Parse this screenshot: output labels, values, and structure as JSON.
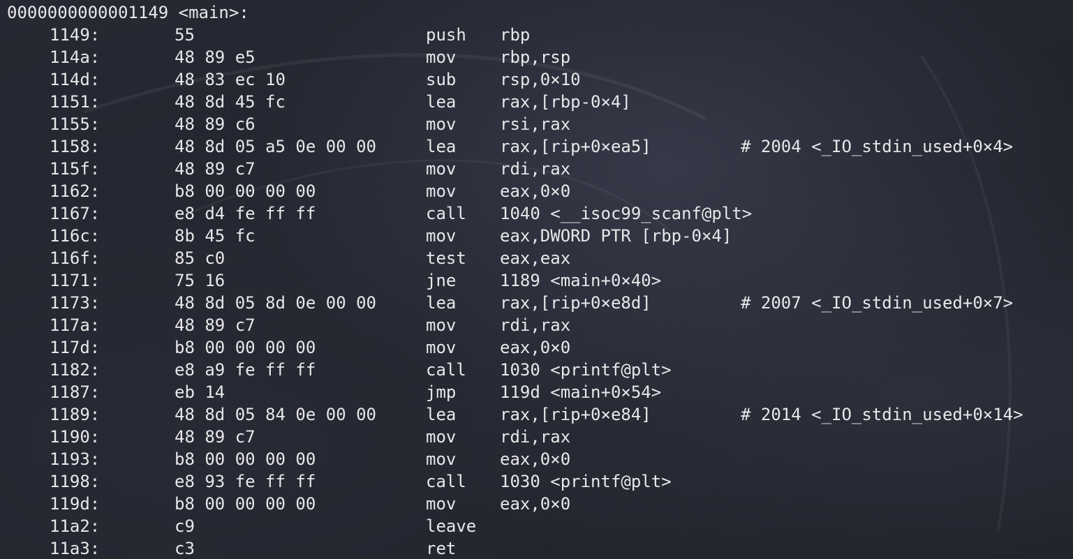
{
  "header": "0000000000001149 <main>:",
  "rows": [
    {
      "addr": "1149:",
      "bytes": "55",
      "mnemonic": "push",
      "operands": "rbp",
      "comment": ""
    },
    {
      "addr": "114a:",
      "bytes": "48 89 e5",
      "mnemonic": "mov",
      "operands": "rbp,rsp",
      "comment": ""
    },
    {
      "addr": "114d:",
      "bytes": "48 83 ec 10",
      "mnemonic": "sub",
      "operands": "rsp,0×10",
      "comment": ""
    },
    {
      "addr": "1151:",
      "bytes": "48 8d 45 fc",
      "mnemonic": "lea",
      "operands": "rax,[rbp-0×4]",
      "comment": ""
    },
    {
      "addr": "1155:",
      "bytes": "48 89 c6",
      "mnemonic": "mov",
      "operands": "rsi,rax",
      "comment": ""
    },
    {
      "addr": "1158:",
      "bytes": "48 8d 05 a5 0e 00 00",
      "mnemonic": "lea",
      "operands": "rax,[rip+0×ea5]",
      "comment": "# 2004 <_IO_stdin_used+0×4>"
    },
    {
      "addr": "115f:",
      "bytes": "48 89 c7",
      "mnemonic": "mov",
      "operands": "rdi,rax",
      "comment": ""
    },
    {
      "addr": "1162:",
      "bytes": "b8 00 00 00 00",
      "mnemonic": "mov",
      "operands": "eax,0×0",
      "comment": ""
    },
    {
      "addr": "1167:",
      "bytes": "e8 d4 fe ff ff",
      "mnemonic": "call",
      "operands": "1040 <__isoc99_scanf@plt>",
      "comment": ""
    },
    {
      "addr": "116c:",
      "bytes": "8b 45 fc",
      "mnemonic": "mov",
      "operands": "eax,DWORD PTR [rbp-0×4]",
      "comment": ""
    },
    {
      "addr": "116f:",
      "bytes": "85 c0",
      "mnemonic": "test",
      "operands": "eax,eax",
      "comment": ""
    },
    {
      "addr": "1171:",
      "bytes": "75 16",
      "mnemonic": "jne",
      "operands": "1189 <main+0×40>",
      "comment": ""
    },
    {
      "addr": "1173:",
      "bytes": "48 8d 05 8d 0e 00 00",
      "mnemonic": "lea",
      "operands": "rax,[rip+0×e8d]",
      "comment": "# 2007 <_IO_stdin_used+0×7>"
    },
    {
      "addr": "117a:",
      "bytes": "48 89 c7",
      "mnemonic": "mov",
      "operands": "rdi,rax",
      "comment": ""
    },
    {
      "addr": "117d:",
      "bytes": "b8 00 00 00 00",
      "mnemonic": "mov",
      "operands": "eax,0×0",
      "comment": ""
    },
    {
      "addr": "1182:",
      "bytes": "e8 a9 fe ff ff",
      "mnemonic": "call",
      "operands": "1030 <printf@plt>",
      "comment": ""
    },
    {
      "addr": "1187:",
      "bytes": "eb 14",
      "mnemonic": "jmp",
      "operands": "119d <main+0×54>",
      "comment": ""
    },
    {
      "addr": "1189:",
      "bytes": "48 8d 05 84 0e 00 00",
      "mnemonic": "lea",
      "operands": "rax,[rip+0×e84]",
      "comment": "# 2014 <_IO_stdin_used+0×14>"
    },
    {
      "addr": "1190:",
      "bytes": "48 89 c7",
      "mnemonic": "mov",
      "operands": "rdi,rax",
      "comment": ""
    },
    {
      "addr": "1193:",
      "bytes": "b8 00 00 00 00",
      "mnemonic": "mov",
      "operands": "eax,0×0",
      "comment": ""
    },
    {
      "addr": "1198:",
      "bytes": "e8 93 fe ff ff",
      "mnemonic": "call",
      "operands": "1030 <printf@plt>",
      "comment": ""
    },
    {
      "addr": "119d:",
      "bytes": "b8 00 00 00 00",
      "mnemonic": "mov",
      "operands": "eax,0×0",
      "comment": ""
    },
    {
      "addr": "11a2:",
      "bytes": "c9",
      "mnemonic": "leave",
      "operands": "",
      "comment": ""
    },
    {
      "addr": "11a3:",
      "bytes": "c3",
      "mnemonic": "ret",
      "operands": "",
      "comment": ""
    }
  ]
}
